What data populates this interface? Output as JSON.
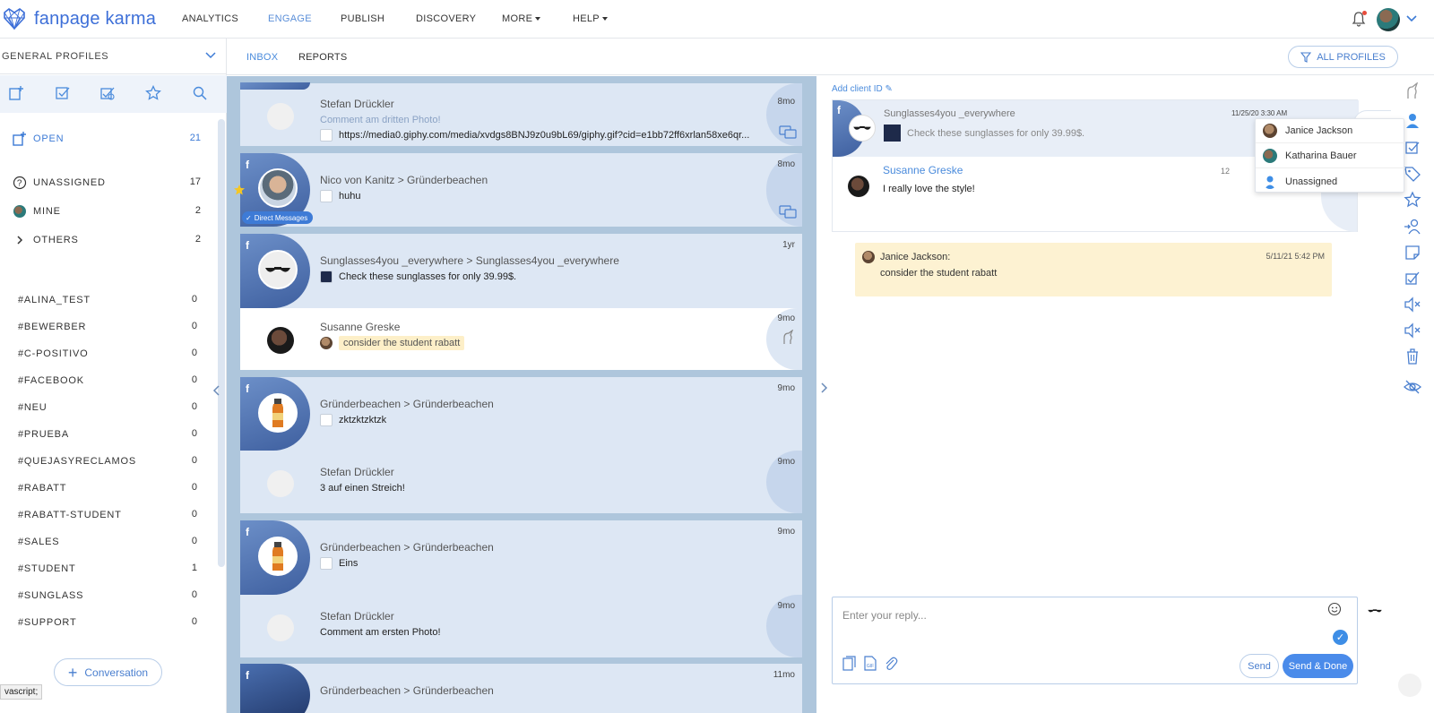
{
  "app": {
    "name": "fanpage karma"
  },
  "nav": {
    "analytics": "ANALYTICS",
    "engage": "ENGAGE",
    "publish": "PUBLISH",
    "discovery": "DISCOVERY",
    "more": "MORE",
    "help": "HELP"
  },
  "sidebar": {
    "profile_selector": "GENERAL PROFILES",
    "open": {
      "label": "OPEN",
      "count": "21"
    },
    "unassigned": {
      "label": "UNASSIGNED",
      "count": "17"
    },
    "mine": {
      "label": "MINE",
      "count": "2"
    },
    "others": {
      "label": "OTHERS",
      "count": "2"
    },
    "tags": [
      {
        "label": "#ALINA_TEST",
        "count": "0"
      },
      {
        "label": "#BEWERBER",
        "count": "0"
      },
      {
        "label": "#C-POSITIVO",
        "count": "0"
      },
      {
        "label": "#FACEBOOK",
        "count": "0"
      },
      {
        "label": "#NEU",
        "count": "0"
      },
      {
        "label": "#PRUEBA",
        "count": "0"
      },
      {
        "label": "#QUEJASYRECLAMOS",
        "count": "0"
      },
      {
        "label": "#RABATT",
        "count": "0"
      },
      {
        "label": "#RABATT-STUDENT",
        "count": "0"
      },
      {
        "label": "#SALES",
        "count": "0"
      },
      {
        "label": "#STUDENT",
        "count": "1"
      },
      {
        "label": "#SUNGLASS",
        "count": "0"
      },
      {
        "label": "#SUPPORT",
        "count": "0"
      }
    ],
    "conversation_button": "Conversation",
    "status_tip": "vascript;"
  },
  "subnav": {
    "inbox": "INBOX",
    "reports": "REPORTS",
    "all_profiles": "ALL PROFILES"
  },
  "list": [
    {
      "title": "Stefan Drückler",
      "sub": "Comment am dritten Photo!",
      "link": "https://media0.giphy.com/media/xvdgs8BNJ9z0u9bL69/giphy.gif?cid=e1bb72ff6xrlan58xe6qr...",
      "time": "8mo"
    },
    {
      "title": "Nico von Kanitz > Gründerbeachen",
      "sub": "huhu",
      "time": "8mo",
      "badge": "Direct Messages"
    },
    {
      "title": "Sunglasses4you _everywhere > Sunglasses4you _everywhere",
      "sub": "Check these sunglasses for only 39.99$.",
      "time": "1yr"
    },
    {
      "title": "Susanne Greske",
      "sub": "consider the student rabatt",
      "time": "9mo"
    },
    {
      "title": "Gründerbeachen > Gründerbeachen",
      "sub": "zktzktzktzk",
      "time": "9mo"
    },
    {
      "title": "Stefan Drückler",
      "sub": "3 auf einen Streich!",
      "time": "9mo"
    },
    {
      "title": "Gründerbeachen > Gründerbeachen",
      "sub": "Eins",
      "time": "9mo"
    },
    {
      "title": "Stefan Drückler",
      "sub": "Comment am ersten Photo!",
      "time": "9mo"
    },
    {
      "title": "Gründerbeachen > Gründerbeachen",
      "time": "11mo"
    }
  ],
  "detail": {
    "add_client": "Add client ID",
    "post_author": "Sunglasses4you _everywhere",
    "post_text": "Check these sunglasses for only 39.99$.",
    "post_time": "11/25/20 3:30 AM",
    "comment_author": "Susanne Greske",
    "comment_text": "I really love the style!",
    "comment_time": "12",
    "note_author": "Janice Jackson:",
    "note_text": "consider the student rabatt",
    "note_time": "5/11/21 5:42 PM",
    "reply_placeholder": "Enter your reply...",
    "send": "Send",
    "send_done": "Send & Done"
  },
  "assign_dropdown": [
    {
      "label": "Janice Jackson"
    },
    {
      "label": "Katharina Bauer"
    },
    {
      "label": "Unassigned"
    }
  ],
  "colors": {
    "accent": "#4a8bdc",
    "brand": "#3d6fd8",
    "list_bg": "#aec6dc",
    "card_bg": "#dde7f4",
    "note_bg": "#fdf2d2"
  }
}
